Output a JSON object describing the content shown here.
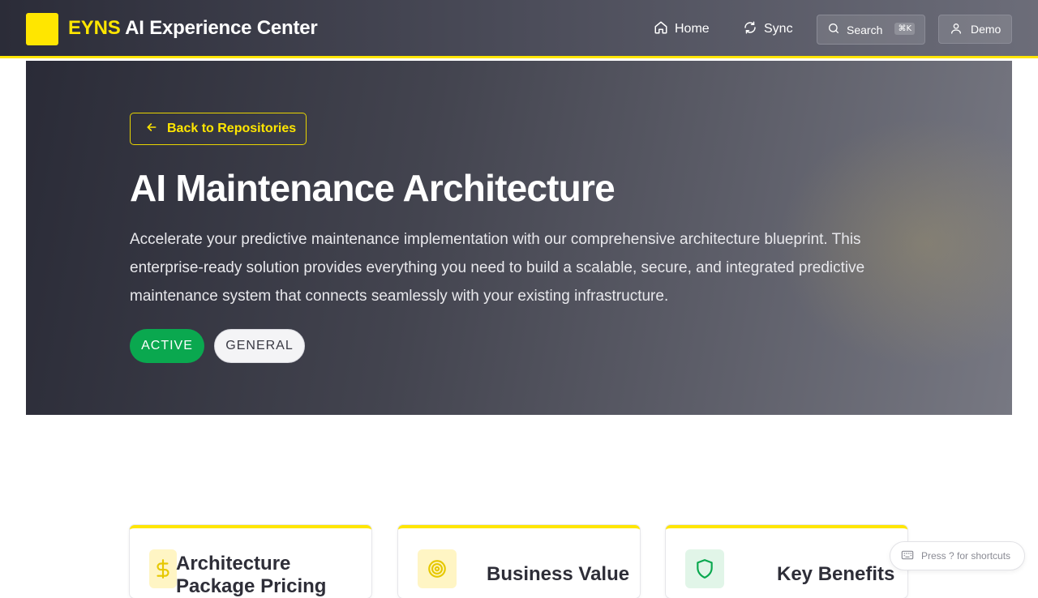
{
  "header": {
    "brand_accent": "EYNS",
    "brand_rest": " AI Experience Center",
    "nav": {
      "home": "Home",
      "sync": "Sync"
    },
    "search": {
      "label": "Search",
      "shortcut": "⌘K"
    },
    "user": {
      "label": "Demo"
    }
  },
  "hero": {
    "back_label": "Back to Repositories",
    "title": "AI Maintenance Architecture",
    "description": "Accelerate your predictive maintenance implementation with our comprehensive architecture blueprint. This enterprise-ready solution provides everything you need to build a scalable, secure, and integrated predictive maintenance system that connects seamlessly with your existing infrastructure.",
    "badges": {
      "status": "ACTIVE",
      "category": "GENERAL"
    }
  },
  "cards": [
    {
      "title": "Architecture Package Pricing",
      "icon": "dollar-icon"
    },
    {
      "title": "Business Value",
      "icon": "target-icon"
    },
    {
      "title": "Key Benefits",
      "icon": "shield-icon"
    }
  ],
  "shortcut_hint": "Press ? for shortcuts",
  "colors": {
    "accent": "#ffe600",
    "active": "#0aa84f",
    "dark": "#2b2c38"
  }
}
